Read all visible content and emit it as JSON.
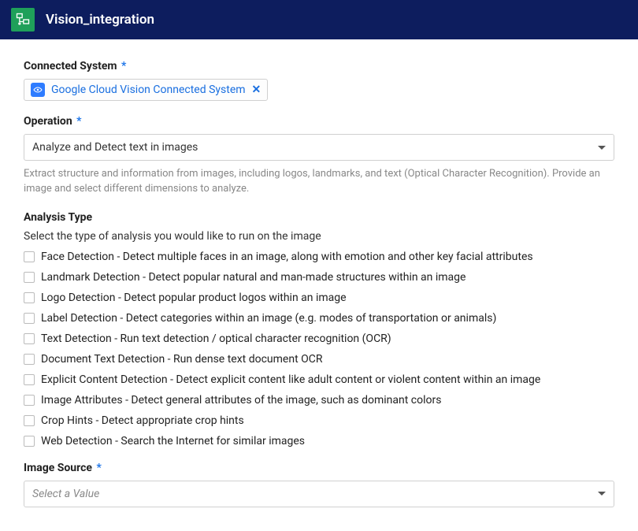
{
  "header": {
    "title": "Vision_integration"
  },
  "connected_system": {
    "label": "Connected System",
    "required_marker": "*",
    "token": "Google Cloud Vision Connected System",
    "close_glyph": "✕"
  },
  "operation": {
    "label": "Operation",
    "required_marker": "*",
    "value": "Analyze and Detect text in images",
    "help": "Extract structure and information from images, including logos, landmarks, and text (Optical Character Recognition). Provide an image and select different dimensions to analyze."
  },
  "analysis_type": {
    "label": "Analysis Type",
    "description": "Select the type of analysis you would like to run on the image",
    "options": [
      "Face Detection - Detect multiple faces in an image, along with emotion and other key facial attributes",
      "Landmark Detection - Detect popular natural and man-made structures within an image",
      "Logo Detection - Detect popular product logos within an image",
      "Label Detection - Detect categories within an image (e.g. modes of transportation or animals)",
      "Text Detection - Run text detection / optical character recognition (OCR)",
      "Document Text Detection - Run dense text document OCR",
      "Explicit Content Detection - Detect explicit content like adult content or violent content within an image",
      "Image Attributes - Detect general attributes of the image, such as dominant colors",
      "Crop Hints - Detect appropriate crop hints",
      "Web Detection - Search the Internet for similar images"
    ]
  },
  "image_source": {
    "label": "Image Source",
    "required_marker": "*",
    "placeholder": "Select a Value"
  }
}
